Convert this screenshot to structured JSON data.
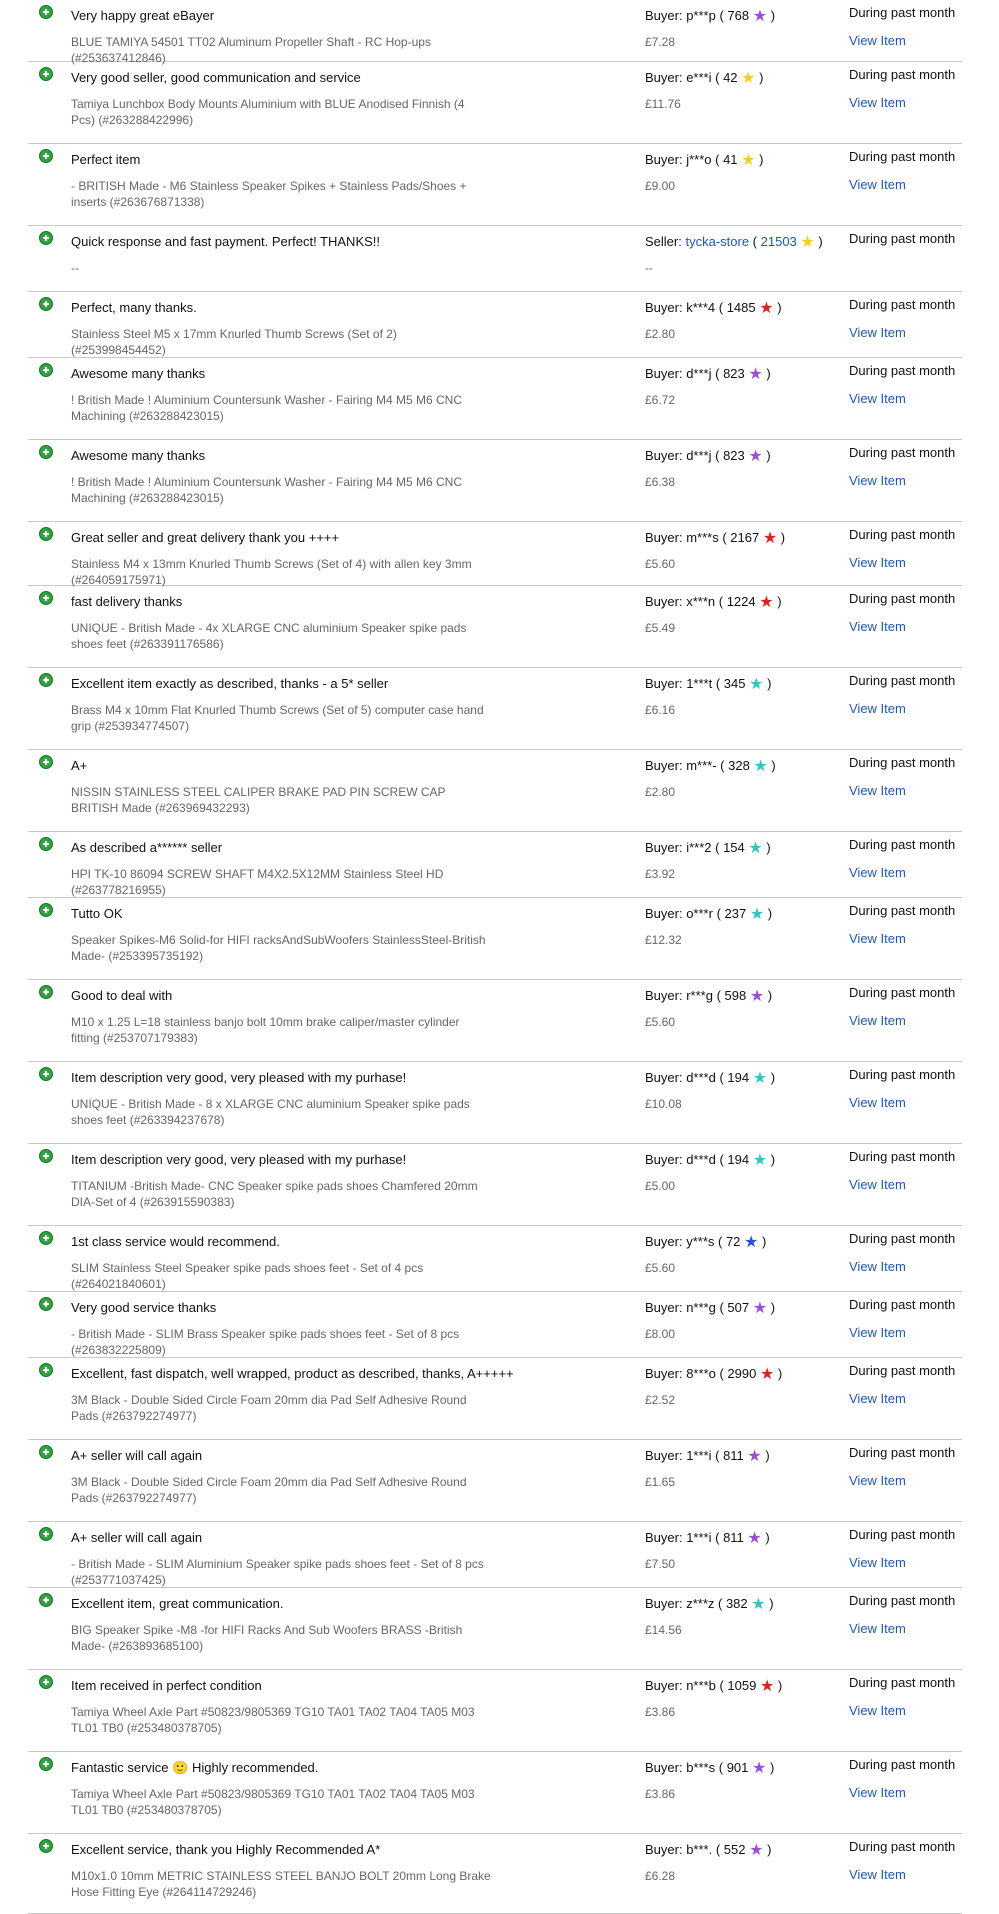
{
  "feedback": [
    {
      "comment": "Very happy great eBayer",
      "role": "Buyer:",
      "user": "p***p",
      "score": "768",
      "star": "purple-star-icon",
      "star_color": "#9b4fd6",
      "item": "BLUE TAMIYA 54501 TT02 Aluminum Propeller Shaft - RC Hop-ups (#253637412846)",
      "price": "£7.28",
      "when": "During past month",
      "link": "View Item"
    },
    {
      "comment": "Very good seller, good communication and service",
      "role": "Buyer:",
      "user": "e***i",
      "score": "42",
      "star": "yellow-star-icon",
      "star_color": "#f2d01e",
      "item": "Tamiya Lunchbox Body Mounts Aluminium with BLUE Anodised Finnish (4 Pcs) (#263288422996)",
      "price": "£11.76",
      "when": "During past month",
      "link": "View Item"
    },
    {
      "comment": "Perfect item",
      "role": "Buyer:",
      "user": "j***o",
      "score": "41",
      "star": "yellow-star-icon",
      "star_color": "#f2d01e",
      "item": "- BRITISH Made - M6 Stainless Speaker Spikes + Stainless Pads/Shoes + inserts (#263676871338)",
      "price": "£9.00",
      "when": "During past month",
      "link": "View Item"
    },
    {
      "comment": "Quick response and fast payment. Perfect! THANKS!!",
      "role": "Seller:",
      "user": "tycka-store",
      "score": "21503",
      "star": "shooting-star-icon",
      "star_color": "#f2d01e",
      "item": "--",
      "price": "--",
      "when": "During past month",
      "link": ""
    },
    {
      "comment": "Perfect, many thanks.",
      "role": "Buyer:",
      "user": "k***4",
      "score": "1485",
      "star": "red-star-icon",
      "star_color": "#e0201c",
      "item": "Stainless Steel M5 x 17mm Knurled Thumb Screws (Set of 2) (#253998454452)",
      "price": "£2.80",
      "when": "During past month",
      "link": "View Item"
    },
    {
      "comment": "Awesome many thanks",
      "role": "Buyer:",
      "user": "d***j",
      "score": "823",
      "star": "purple-star-icon",
      "star_color": "#9b4fd6",
      "item": "! British Made ! Aluminium Countersunk Washer - Fairing M4 M5 M6 CNC Machining (#263288423015)",
      "price": "£6.72",
      "when": "During past month",
      "link": "View Item"
    },
    {
      "comment": "Awesome many thanks",
      "role": "Buyer:",
      "user": "d***j",
      "score": "823",
      "star": "purple-star-icon",
      "star_color": "#9b4fd6",
      "item": "! British Made ! Aluminium Countersunk Washer - Fairing M4 M5 M6 CNC Machining (#263288423015)",
      "price": "£6.38",
      "when": "During past month",
      "link": "View Item"
    },
    {
      "comment": "Great seller and great delivery thank you ++++",
      "role": "Buyer:",
      "user": "m***s",
      "score": "2167",
      "star": "red-star-icon",
      "star_color": "#e0201c",
      "item": "Stainless M4 x 13mm Knurled Thumb Screws (Set of 4) with allen key 3mm (#264059175971)",
      "price": "£5.60",
      "when": "During past month",
      "link": "View Item"
    },
    {
      "comment": "fast delivery thanks",
      "role": "Buyer:",
      "user": "x***n",
      "score": "1224",
      "star": "red-star-icon",
      "star_color": "#e0201c",
      "item": "UNIQUE - British Made - 4x XLARGE CNC aluminium Speaker spike pads shoes feet (#263391176586)",
      "price": "£5.49",
      "when": "During past month",
      "link": "View Item"
    },
    {
      "comment": "Excellent item exactly as described, thanks - a 5* seller",
      "role": "Buyer:",
      "user": "1***t",
      "score": "345",
      "star": "turquoise-star-icon",
      "star_color": "#2fc7c0",
      "item": "Brass M4 x 10mm Flat Knurled Thumb Screws (Set of 5) computer case hand grip (#253934774507)",
      "price": "£6.16",
      "when": "During past month",
      "link": "View Item"
    },
    {
      "comment": "A+",
      "role": "Buyer:",
      "user": "m***-",
      "score": "328",
      "star": "turquoise-star-icon",
      "star_color": "#2fc7c0",
      "item": "NISSIN STAINLESS STEEL CALIPER BRAKE PAD PIN SCREW CAP BRITISH Made (#263969432293)",
      "price": "£2.80",
      "when": "During past month",
      "link": "View Item"
    },
    {
      "comment": "As described a****** seller",
      "role": "Buyer:",
      "user": "i***2",
      "score": "154",
      "star": "turquoise-star-icon",
      "star_color": "#2fc7c0",
      "item": "HPI TK-10 86094 SCREW SHAFT M4X2.5X12MM Stainless Steel HD (#263778216955)",
      "price": "£3.92",
      "when": "During past month",
      "link": "View Item"
    },
    {
      "comment": "Tutto OK",
      "role": "Buyer:",
      "user": "o***r",
      "score": "237",
      "star": "turquoise-star-icon",
      "star_color": "#2fc7c0",
      "item": "Speaker Spikes-M6 Solid-for HIFI racksAndSubWoofers StainlessSteel-British Made- (#253395735192)",
      "price": "£12.32",
      "when": "During past month",
      "link": "View Item"
    },
    {
      "comment": "Good to deal with",
      "role": "Buyer:",
      "user": "r***g",
      "score": "598",
      "star": "purple-star-icon",
      "star_color": "#9b4fd6",
      "item": "M10 x 1.25 L=18 stainless banjo bolt 10mm brake caliper/master cylinder fitting (#253707179383)",
      "price": "£5.60",
      "when": "During past month",
      "link": "View Item"
    },
    {
      "comment": "Item description very good, very pleased with my purhase!",
      "role": "Buyer:",
      "user": "d***d",
      "score": "194",
      "star": "turquoise-star-icon",
      "star_color": "#2fc7c0",
      "item": "UNIQUE - British Made - 8 x XLARGE CNC aluminium Speaker spike pads shoes feet (#263394237678)",
      "price": "£10.08",
      "when": "During past month",
      "link": "View Item"
    },
    {
      "comment": "Item description very good, very pleased with my purhase!",
      "role": "Buyer:",
      "user": "d***d",
      "score": "194",
      "star": "turquoise-star-icon",
      "star_color": "#2fc7c0",
      "item": "TITANIUM -British Made- CNC Speaker spike pads shoes Chamfered 20mm DIA-Set of 4 (#263915590383)",
      "price": "£5.00",
      "when": "During past month",
      "link": "View Item"
    },
    {
      "comment": "1st class service would recommend.",
      "role": "Buyer:",
      "user": "y***s",
      "score": "72",
      "star": "blue-star-icon",
      "star_color": "#2a4fe0",
      "item": "SLIM Stainless Steel Speaker spike pads shoes feet - Set of 4 pcs (#264021840601)",
      "price": "£5.60",
      "when": "During past month",
      "link": "View Item"
    },
    {
      "comment": "Very good service thanks",
      "role": "Buyer:",
      "user": "n***g",
      "score": "507",
      "star": "purple-star-icon",
      "star_color": "#9b4fd6",
      "item": "- British Made - SLIM Brass Speaker spike pads shoes feet - Set of 8 pcs (#263832225809)",
      "price": "£8.00",
      "when": "During past month",
      "link": "View Item"
    },
    {
      "comment": "Excellent, fast dispatch, well wrapped, product as described, thanks, A+++++",
      "role": "Buyer:",
      "user": "8***o",
      "score": "2990",
      "star": "red-star-icon",
      "star_color": "#e0201c",
      "item": "3M Black - Double Sided Circle Foam 20mm dia Pad Self Adhesive Round Pads (#263792274977)",
      "price": "£2.52",
      "when": "During past month",
      "link": "View Item"
    },
    {
      "comment": "A+ seller will call again",
      "role": "Buyer:",
      "user": "1***i",
      "score": "811",
      "star": "purple-star-icon",
      "star_color": "#9b4fd6",
      "item": "3M Black - Double Sided Circle Foam 20mm dia Pad Self Adhesive Round Pads (#263792274977)",
      "price": "£1.65",
      "when": "During past month",
      "link": "View Item"
    },
    {
      "comment": "A+ seller will call again",
      "role": "Buyer:",
      "user": "1***i",
      "score": "811",
      "star": "purple-star-icon",
      "star_color": "#9b4fd6",
      "item": "- British Made - SLIM Aluminium Speaker spike pads shoes feet - Set of 8 pcs (#253771037425)",
      "price": "£7.50",
      "when": "During past month",
      "link": "View Item"
    },
    {
      "comment": "Excellent item, great communication.",
      "role": "Buyer:",
      "user": "z***z",
      "score": "382",
      "star": "turquoise-star-icon",
      "star_color": "#2fc7c0",
      "item": "BIG Speaker Spike -M8 -for HIFI Racks And Sub Woofers BRASS -British Made- (#263893685100)",
      "price": "£14.56",
      "when": "During past month",
      "link": "View Item"
    },
    {
      "comment": "Item received in perfect condition",
      "role": "Buyer:",
      "user": "n***b",
      "score": "1059",
      "star": "red-star-icon",
      "star_color": "#e0201c",
      "item": "Tamiya Wheel Axle Part #50823/9805369 TG10 TA01 TA02 TA04 TA05 M03 TL01 TB0 (#253480378705)",
      "price": "£3.86",
      "when": "During past month",
      "link": "View Item"
    },
    {
      "comment": "Fantastic service 🙂 Highly recommended.",
      "role": "Buyer:",
      "user": "b***s",
      "score": "901",
      "star": "purple-star-icon",
      "star_color": "#9b4fd6",
      "item": "Tamiya Wheel Axle Part #50823/9805369 TG10 TA01 TA02 TA04 TA05 M03 TL01 TB0 (#253480378705)",
      "price": "£3.86",
      "when": "During past month",
      "link": "View Item"
    },
    {
      "comment": "Excellent service, thank you Highly Recommended A*",
      "role": "Buyer:",
      "user": "b***.",
      "score": "552",
      "star": "purple-star-icon",
      "star_color": "#9b4fd6",
      "item": "M10x1.0 10mm METRIC STAINLESS STEEL BANJO BOLT 20mm Long Brake Hose Fitting Eye (#264114729246)",
      "price": "£6.28",
      "when": "During past month",
      "link": "View Item"
    }
  ]
}
